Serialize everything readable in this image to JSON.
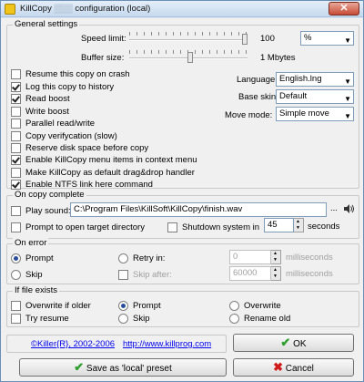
{
  "window": {
    "title_app": "KillCopy",
    "title_rest": "configuration (local)",
    "close_glyph": "✕",
    "logo_icon": "killcopy-logo-icon"
  },
  "general": {
    "legend": "General settings",
    "speed_limit_label": "Speed limit:",
    "speed_value": "100",
    "speed_unit": "%",
    "buffer_size_label": "Buffer size:",
    "buffer_value": "1 Mbytes",
    "options": [
      {
        "label": "Resume this copy on crash",
        "checked": false
      },
      {
        "label": "Log this copy to history",
        "checked": true
      },
      {
        "label": "Read boost",
        "checked": true
      },
      {
        "label": "Write boost",
        "checked": false
      },
      {
        "label": "Parallel read/write",
        "checked": false
      },
      {
        "label": "Copy verifycation (slow)",
        "checked": false
      },
      {
        "label": "Reserve disk space before copy",
        "checked": false
      },
      {
        "label": "Enable KillCopy menu items in context menu",
        "checked": true
      },
      {
        "label": "Make KillCopy as default drag&drop handler",
        "checked": false
      },
      {
        "label": "Enable NTFS link here command",
        "checked": true
      }
    ],
    "language_label": "Language:",
    "language_value": "English.lng",
    "base_skin_label": "Base skin:",
    "base_skin_value": "Default",
    "move_mode_label": "Move mode:",
    "move_mode_value": "Simple move"
  },
  "on_complete": {
    "legend": "On copy complete",
    "play_sound_label": "Play sound:",
    "play_sound_checked": false,
    "sound_path": "C:\\Program Files\\KillSoft\\KillCopy\\finish.wav",
    "browse_label": "...",
    "prompt_dir_label": "Prompt to open target directory",
    "prompt_dir_checked": false,
    "shutdown_label": "Shutdown system in",
    "shutdown_checked": false,
    "shutdown_value": "45",
    "shutdown_unit": "seconds"
  },
  "on_error": {
    "legend": "On error",
    "prompt_label": "Prompt",
    "prompt_selected": true,
    "skip_label": "Skip",
    "skip_selected": false,
    "retry_label": "Retry in:",
    "retry_selected": false,
    "retry_value": "0",
    "retry_unit": "milliseconds",
    "skip_after_label": "Skip after:",
    "skip_after_checked": false,
    "skip_after_value": "60000",
    "skip_after_unit": "milliseconds"
  },
  "if_exists": {
    "legend": "If file exists",
    "overwrite_older_label": "Overwrite if older",
    "overwrite_older_checked": false,
    "try_resume_label": "Try resume",
    "try_resume_checked": false,
    "prompt_label": "Prompt",
    "prompt_selected": true,
    "skip_label": "Skip",
    "skip_selected": false,
    "overwrite_label": "Overwrite",
    "overwrite_selected": false,
    "rename_old_label": "Rename old",
    "rename_old_selected": false
  },
  "footer": {
    "copyright": "©Killer{R}, 2002-2006",
    "url": "http://www.killprog.com",
    "ok_label": "OK",
    "save_preset_label": "Save as 'local' preset",
    "cancel_label": "Cancel"
  },
  "colors": {
    "check_green": "#2f9e2f",
    "cancel_red": "#d11a1a",
    "link_blue": "#0000ee"
  }
}
